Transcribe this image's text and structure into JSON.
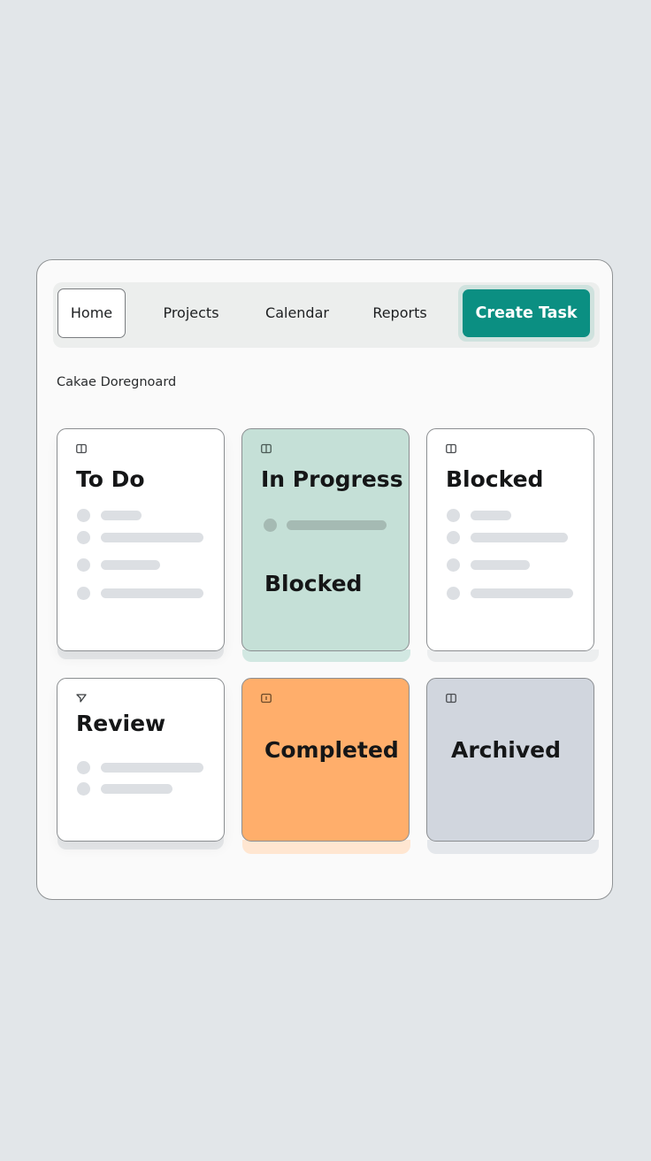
{
  "nav": {
    "items": [
      {
        "label": "Home",
        "active": true
      },
      {
        "label": "Projects",
        "active": false
      },
      {
        "label": "Calendar",
        "active": false
      },
      {
        "label": "Reports",
        "active": false
      }
    ],
    "create_button": "Create Task"
  },
  "board": {
    "subtitle": "Cakae Doregnoard",
    "columns": [
      {
        "title": "To Do",
        "icon": "board-icon",
        "placeholder_rows": 4
      },
      {
        "title": "In Progress",
        "icon": "board-icon",
        "placeholder_rows": 1,
        "secondary_label": "Blocked",
        "color": "#c5e0d7"
      },
      {
        "title": "Blocked",
        "icon": "board-icon",
        "placeholder_rows": 4
      },
      {
        "title": "Review",
        "icon": "send-icon",
        "placeholder_rows": 2
      },
      {
        "title": "Completed",
        "icon": "info-icon",
        "placeholder_rows": 0,
        "color": "#ffae6b"
      },
      {
        "title": "Archived",
        "icon": "board-icon",
        "placeholder_rows": 0,
        "color": "#d1d6de"
      }
    ]
  },
  "colors": {
    "accent": "#0b8f82",
    "background": "#e2e6e9",
    "placeholder": "#dcdfe3"
  }
}
